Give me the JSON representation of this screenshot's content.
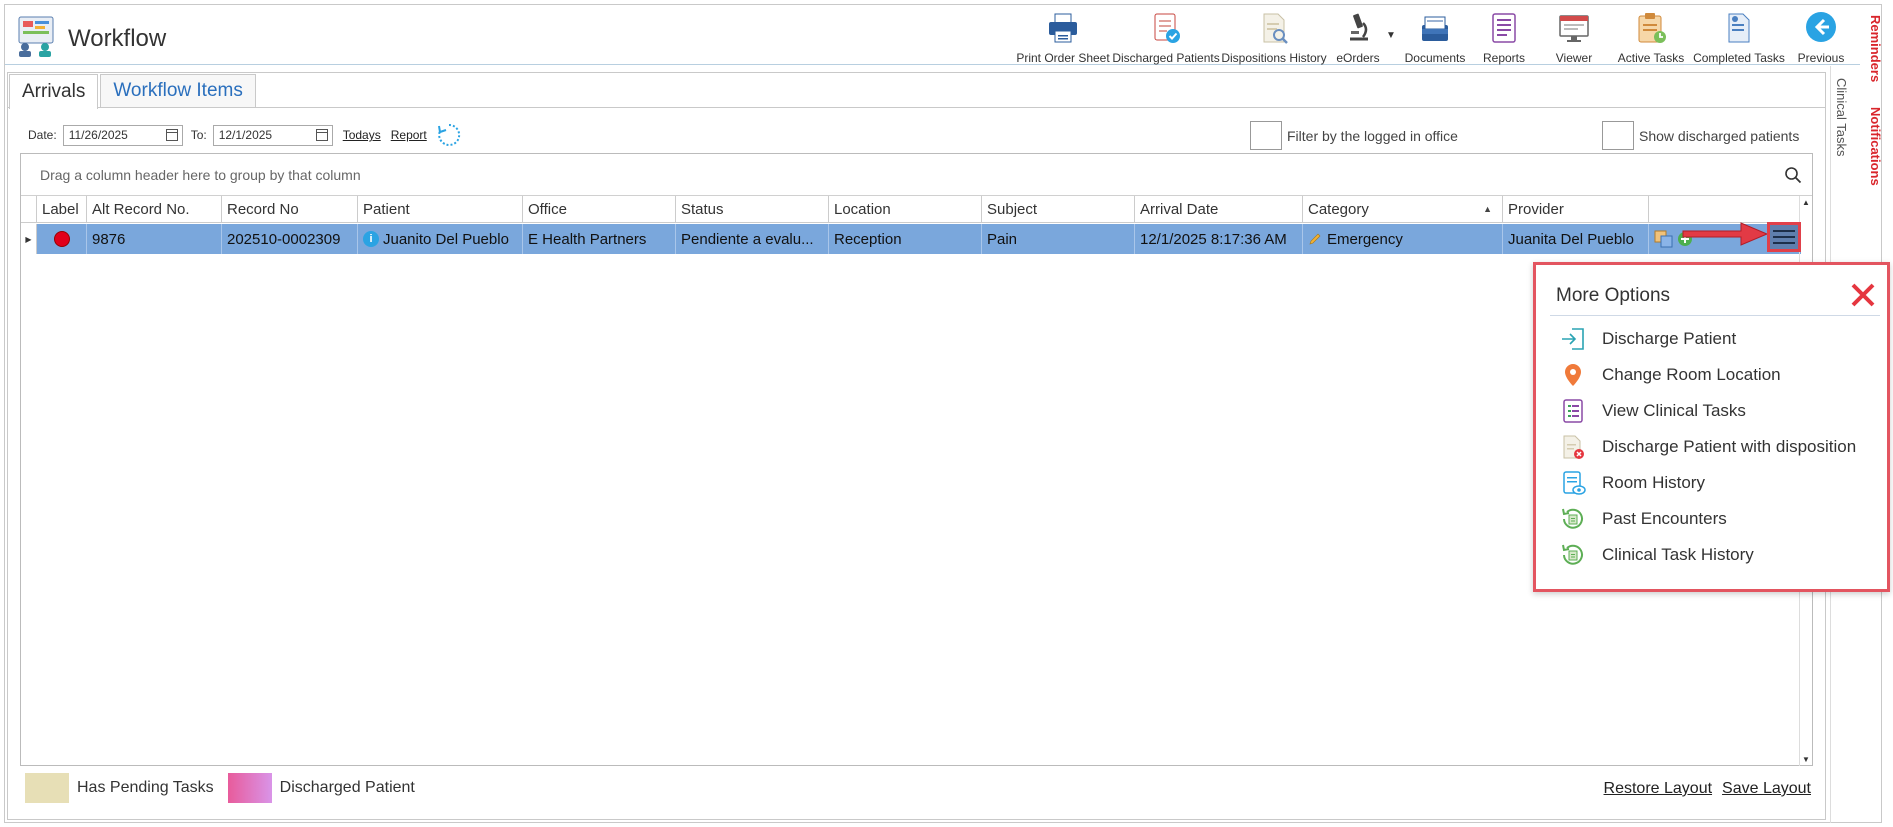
{
  "app": {
    "title": "Workflow"
  },
  "toolbar": [
    {
      "name": "print-order-sheet-button",
      "label": "Print Order Sheet"
    },
    {
      "name": "discharged-patients-button",
      "label": "Discharged Patients"
    },
    {
      "name": "dispositions-history-button",
      "label": "Dispositions History"
    },
    {
      "name": "eorders-button",
      "label": "eOrders"
    },
    {
      "name": "documents-button",
      "label": "Documents"
    },
    {
      "name": "reports-button",
      "label": "Reports"
    },
    {
      "name": "viewer-button",
      "label": "Viewer"
    },
    {
      "name": "active-tasks-button",
      "label": "Active Tasks"
    },
    {
      "name": "completed-tasks-button",
      "label": "Completed Tasks"
    },
    {
      "name": "previous-button",
      "label": "Previous"
    }
  ],
  "side_tabs": {
    "reminders": "Reminders",
    "notifications": "Notifications",
    "clinical_tasks": "Clinical Tasks"
  },
  "tabs": {
    "arrivals": "Arrivals",
    "workflow_items": "Workflow Items"
  },
  "filters": {
    "date_label": "Date:",
    "date_from": "11/26/2025",
    "to_label": "To:",
    "date_to": "12/1/2025",
    "todays_link": "Todays",
    "report_link": "Report",
    "filter_office_label": "Filter by the logged in office",
    "show_discharged_label": "Show discharged patients"
  },
  "grid": {
    "group_hint": "Drag a column header here to group by that column",
    "columns": [
      "Label",
      "Alt Record No.",
      "Record No",
      "Patient",
      "Office",
      "Status",
      "Location",
      "Subject",
      "Arrival Date",
      "Category",
      "Provider"
    ],
    "sorted_column": "Category",
    "rows": [
      {
        "label_color": "#e2001a",
        "alt_record_no": "9876",
        "record_no": "202510-0002309",
        "patient": "Juanito Del Pueblo",
        "office": "E Health Partners",
        "status": "Pendiente a evalu...",
        "location": "Reception",
        "subject": "Pain",
        "arrival_date": "12/1/2025 8:17:36 AM",
        "category": "Emergency",
        "provider": "Juanita Del Pueblo"
      }
    ]
  },
  "more_options": {
    "title": "More Options",
    "items": [
      {
        "label": "Discharge Patient",
        "icon": "discharge-icon"
      },
      {
        "label": "Change Room Location",
        "icon": "map-pin-icon"
      },
      {
        "label": "View Clinical Tasks",
        "icon": "task-list-icon"
      },
      {
        "label": "Discharge Patient with disposition",
        "icon": "document-x-icon"
      },
      {
        "label": "Room History",
        "icon": "room-history-icon"
      },
      {
        "label": "Past Encounters",
        "icon": "past-encounters-icon"
      },
      {
        "label": "Clinical Task History",
        "icon": "clinical-task-history-icon"
      }
    ]
  },
  "legend": {
    "pending": "Has Pending Tasks",
    "discharged": "Discharged Patient"
  },
  "footer": {
    "restore_layout": "Restore Layout",
    "save_layout": "Save Layout"
  }
}
